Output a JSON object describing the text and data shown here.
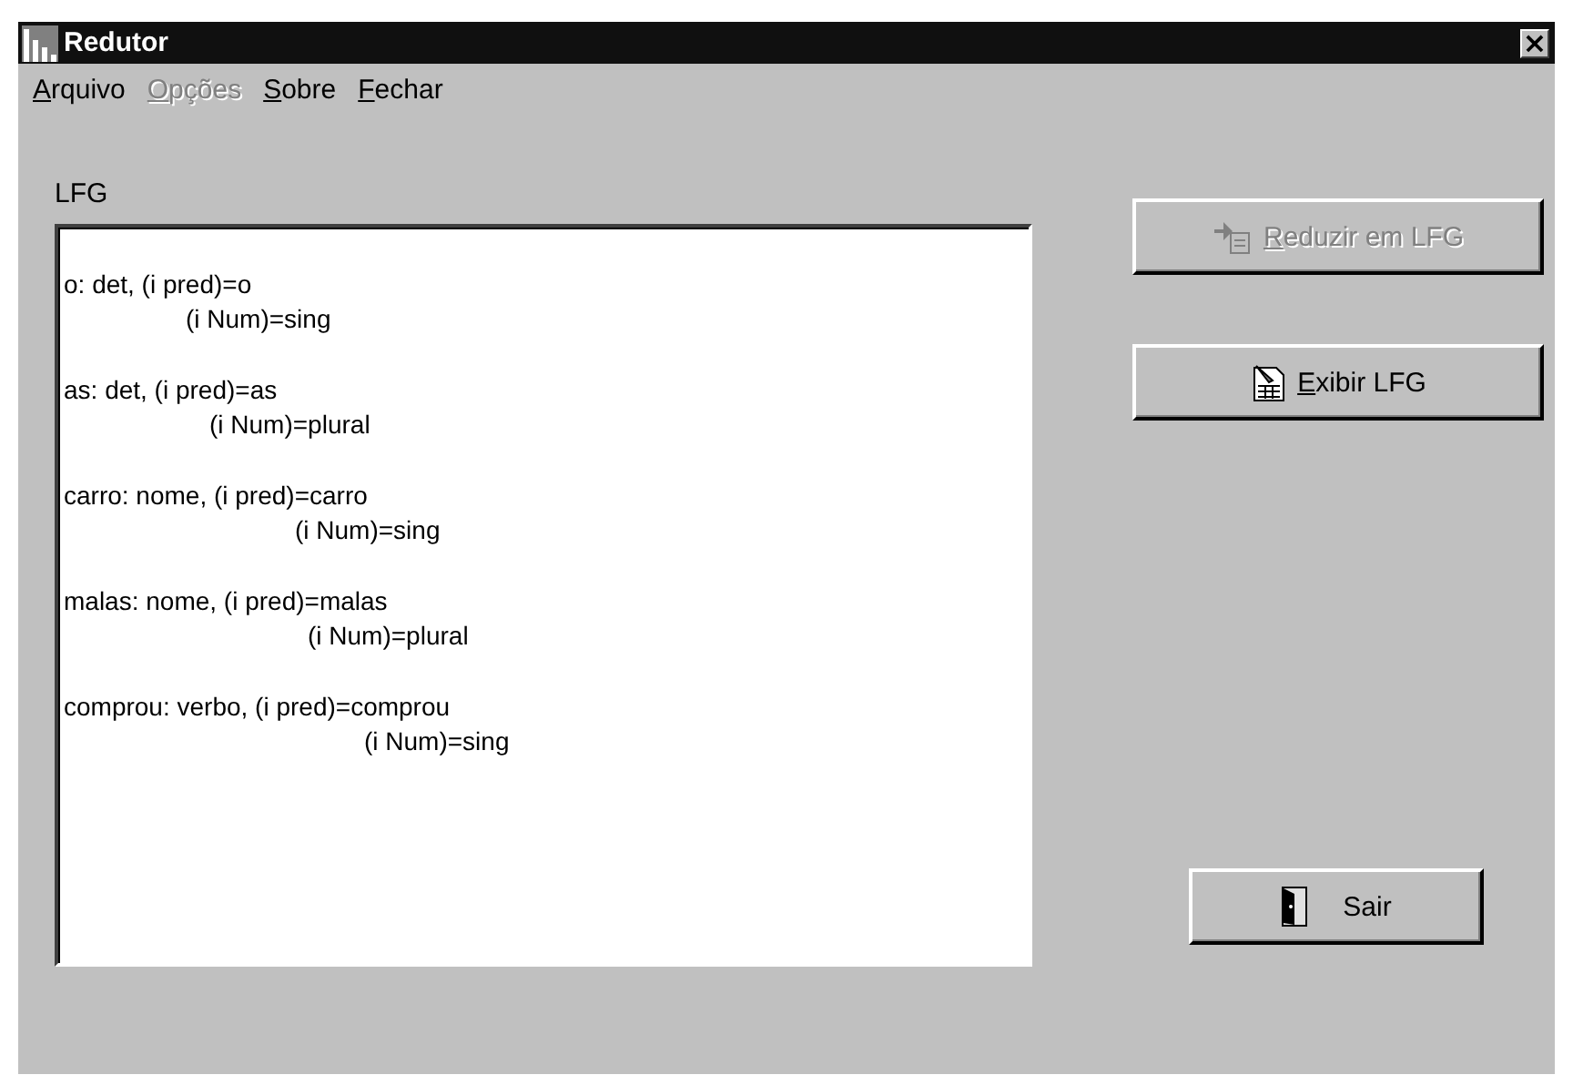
{
  "window": {
    "title": "Redutor",
    "close": "×"
  },
  "menu": [
    {
      "label": "Arquivo",
      "disabled": false,
      "mnemonic": true
    },
    {
      "label": "Opções",
      "disabled": true,
      "mnemonic": true
    },
    {
      "label": "Sobre",
      "disabled": false,
      "mnemonic": true
    },
    {
      "label": "Fechar",
      "disabled": false,
      "mnemonic": true
    }
  ],
  "lfg": {
    "label": "LFG",
    "entries": [
      {
        "line_1": "o: det, (i pred)=o",
        "line_2": "(i Num)=sing"
      },
      {
        "line_1": "as: det, (i pred)=as",
        "line_2": "(i Num)=plural"
      },
      {
        "line_1": "carro: nome, (i pred)=carro",
        "line_2": "(i Num)=sing"
      },
      {
        "line_1": "malas: nome, (i pred)=malas",
        "line_2": "(i Num)=plural"
      },
      {
        "line_1": "comprou: verbo, (i pred)=comprou",
        "line_2": "(i Num)=sing"
      }
    ]
  },
  "buttons": [
    {
      "kind": "reduce",
      "label": "Reduzir em LFG",
      "disabled": true,
      "mnemonic": true
    },
    {
      "kind": "show",
      "label": "Exibir LFG",
      "disabled": false,
      "mnemonic": true
    },
    {
      "kind": "exit",
      "label": "Sair",
      "disabled": false,
      "mnemonic": false
    }
  ]
}
